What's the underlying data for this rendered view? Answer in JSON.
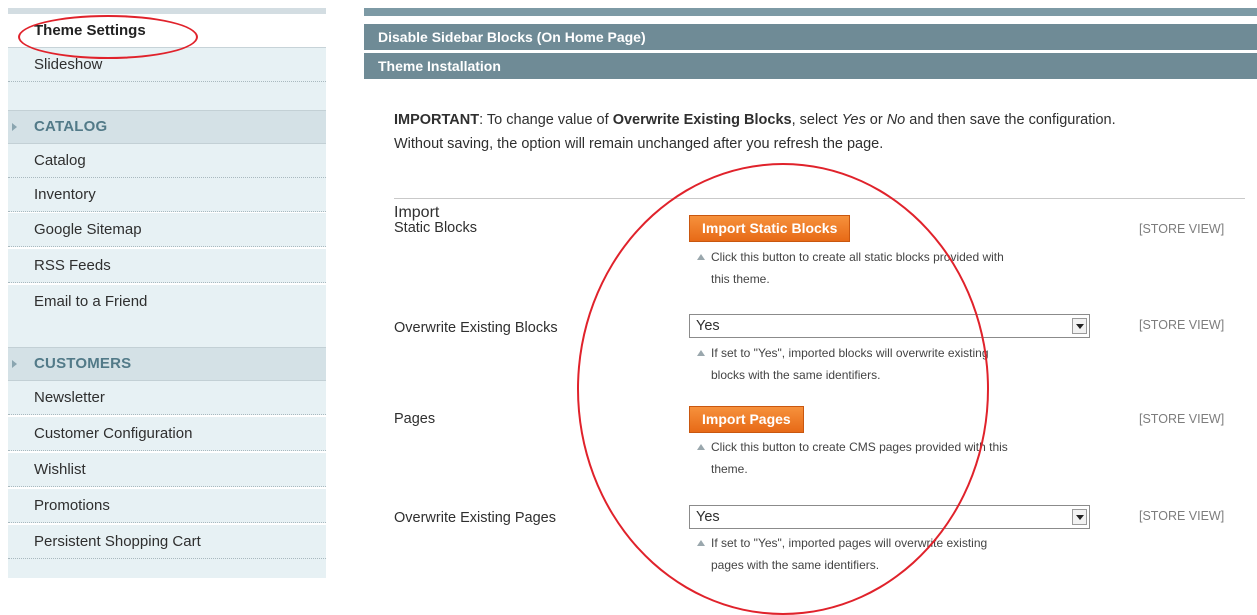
{
  "sidebar": {
    "top_items": [
      {
        "label": "Theme Settings",
        "active": true
      },
      {
        "label": "Slideshow",
        "active": false
      }
    ],
    "sections": [
      {
        "title": "CATALOG",
        "items": [
          "Catalog",
          "Inventory",
          "Google Sitemap",
          "RSS Feeds",
          "Email to a Friend"
        ]
      },
      {
        "title": "CUSTOMERS",
        "items": [
          "Newsletter",
          "Customer Configuration",
          "Wishlist",
          "Promotions",
          "Persistent Shopping Cart"
        ]
      }
    ]
  },
  "main": {
    "headers": [
      "Disable Sidebar Blocks (On Home Page)",
      "Theme Installation"
    ],
    "important": {
      "lead": "IMPORTANT",
      "part1": ": To change value of ",
      "bold": "Overwrite Existing Blocks",
      "part2": ", select ",
      "yes": "Yes",
      "or": " or ",
      "no": "No",
      "part3": " and then save the configuration.",
      "line2": "Without saving, the option will remain unchanged after you refresh the page."
    },
    "import_title": "Import",
    "rows": [
      {
        "label": "Static Blocks",
        "button": "Import Static Blocks",
        "note1": "Click this button to create all static blocks provided with",
        "note2": "this theme.",
        "scope": "[STORE VIEW]"
      },
      {
        "label": "Overwrite Existing Blocks",
        "select_value": "Yes",
        "note1": "If set to \"Yes\", imported blocks will overwrite existing",
        "note2": "blocks with the same identifiers.",
        "scope": "[STORE VIEW]"
      },
      {
        "label": "Pages",
        "button": "Import Pages",
        "note1": "Click this button to create CMS pages provided with this",
        "note2": "theme.",
        "scope": "[STORE VIEW]"
      },
      {
        "label": "Overwrite Existing Pages",
        "select_value": "Yes",
        "note1": "If set to \"Yes\", imported pages will overwrite existing",
        "note2": "pages with the same identifiers.",
        "scope": "[STORE VIEW]"
      }
    ]
  },
  "colors": {
    "header_bg": "#6f8b96",
    "sidebar_bg": "#e7f1f4",
    "section_text": "#527a88",
    "button_orange": "#e76a17",
    "annotation_red": "#e0222b"
  },
  "icons": [
    "expand-arrow-icon",
    "note-triangle-icon",
    "select-caret-icon"
  ]
}
